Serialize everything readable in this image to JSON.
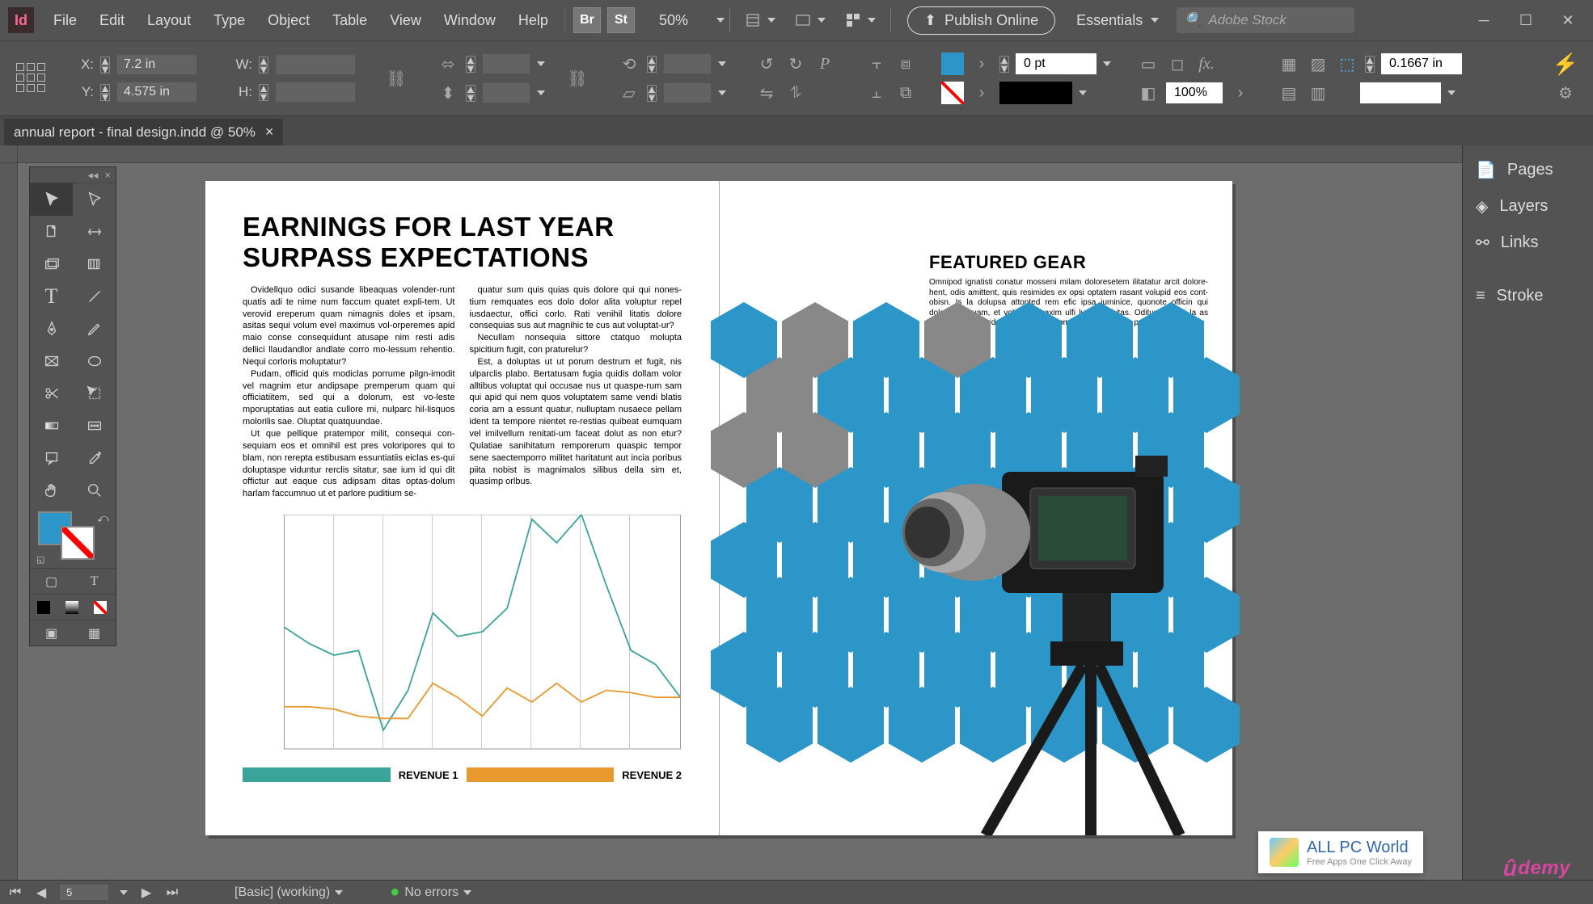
{
  "menu": {
    "items": [
      "File",
      "Edit",
      "Layout",
      "Type",
      "Object",
      "Table",
      "View",
      "Window",
      "Help"
    ],
    "zoom": "50%",
    "publish": "Publish Online",
    "workspace": "Essentials",
    "search_placeholder": "Adobe Stock",
    "br": "Br",
    "st": "St"
  },
  "control": {
    "x_label": "X:",
    "x_val": "7.2 in",
    "y_label": "Y:",
    "y_val": "4.575 in",
    "w_label": "W:",
    "w_val": "",
    "h_label": "H:",
    "h_val": "",
    "stroke_pt": "0 pt",
    "opacity": "100%",
    "indent": "0.1667 in"
  },
  "tab": {
    "title": "annual report - final design.indd @ 50%"
  },
  "panels": {
    "pages": "Pages",
    "layers": "Layers",
    "links": "Links",
    "stroke": "Stroke"
  },
  "status": {
    "page": "5",
    "preset": "[Basic] (working)",
    "errors": "No errors"
  },
  "doc": {
    "headline": "EARNINGS FOR LAST YEAR SURPASS EXPECTATIONS",
    "col1p1": "Ovidellquo odici susande libeaquas volender-runt quatis adi te nime num faccum quatet expli-tem. Ut verovid ereperum quam nimagnis doles et ipsam, asitas sequi volum evel maximus vol-orperemes apid maio conse consequidunt atusape nim resti adis dellici llaudandlor andlate corro mo-lessum rehentio. Nequi corloris moluptatur?",
    "col1p2": "Pudam, officid quis modiclas porrume pilgn-imodit vel magnim etur andipsape premperum quam qui officiatiitem, sed qui a dolorum, est vo-leste mporuptatias aut eatia cullore mi, nulparc hil-lisquos molorilis sae. Oluptat quatquundae.",
    "col1p3": "Ut que pellique pratempor milit, consequi con-sequiam eos et omnihil est pres voloripores qui to blam, non rerepta estibusam essuntiatiis eiclas es-qui doluptaspe viduntur rerclis sitatur, sae ium id qui dit offictur aut eaque cus adipsam ditas optas-dolum harlam faccumnuo ut et parlore puditium se-",
    "col2p1": "quatur sum quis quias quis dolore qui qui nones-tium remquates eos dolo dolor alita voluptur repel iusdaectur, offici corlo. Rati venihil litatis dolore consequias sus aut magnihic te cus aut voluptat-ur?",
    "col2p2": "Necullam nonsequia sittore ctatquo molupta spicitium fugit, con praturelur?",
    "col2p3": "Est, a doluptas ut ut porum destrum et fugit, nis ulparclis plabo. Bertatusam fugia quidis dollam volor alltibus voluptat qui occusae nus ut quaspe-rum sam qui apid qui nem quos voluptatem same vendi blatis coria am a essunt quatur, nulluptam nusaece pellam ident ta tempore nientet re-restias quibeat eumquam vel imilvellum renitati-um faceat dolut as non etur? Qulatiae sanihitatum remporerum quaspic tempor sene saectemporro militet haritatunt aut incia poribus piita nobist is magnimalos silibus della sim et, quasimp orlbus.",
    "legend1": "REVENUE 1",
    "legend2": "REVENUE 2",
    "featured_title": "FEATURED GEAR",
    "featured_body": "Omnipod ignatisti conatur mosseni milam doloresetem ilitatatur arcit dolore-hent, odis amittent, quis resimides ex opsi optatem rasant volupid eos cont-obisn. Is la dolupsa attonted rem efic ipsa iuminice, quonote officin qui dolaptium quam, et voluptior maxim ulfi lurem nobitas. Oditunt eli qui la as conet-prae sinquida cipsam faccuet omnimilli quodia qus prat plia que lamet."
  },
  "chart_data": {
    "type": "line",
    "x_ticks": 8,
    "ylim": [
      0,
      100
    ],
    "series": [
      {
        "name": "REVENUE 1",
        "color": "#3aa39a",
        "values": [
          52,
          45,
          40,
          42,
          8,
          25,
          58,
          48,
          50,
          60,
          98,
          88,
          100,
          70,
          42,
          36,
          22
        ]
      },
      {
        "name": "REVENUE 2",
        "color": "#e8992e",
        "values": [
          18,
          18,
          17,
          14,
          13,
          13,
          28,
          22,
          14,
          26,
          20,
          28,
          20,
          25,
          24,
          22,
          22
        ]
      }
    ]
  },
  "watermark": {
    "title": "ALL PC World",
    "subtitle": "Free Apps One Click Away"
  },
  "udemy": "demy"
}
